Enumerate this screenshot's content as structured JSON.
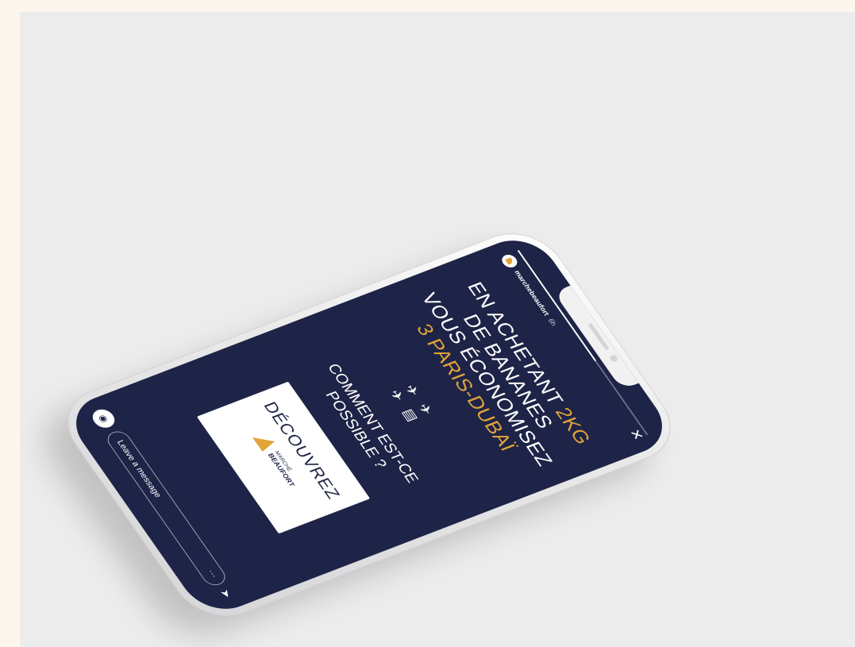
{
  "story": {
    "username": "marchebeaufort",
    "time": "6h",
    "progress_fraction": 0.6,
    "close_glyph": "✕",
    "headline": {
      "line1_a": "EN ACHETANT",
      "line1_b": "2KG",
      "line2": "DE BANANES",
      "line3": "VOUS ÉCONOMISEZ",
      "line4": "3 PARIS-DUBAÏ"
    },
    "icons": [
      "plane-icon",
      "plane-icon",
      "plane-icon",
      "banana-crate-icon"
    ],
    "question": {
      "line1": "COMMENT EST-CE",
      "line2": "POSSIBLE ?"
    },
    "cta": {
      "title": "DÉCOUVREZ",
      "logo_line1": "MARCHÉ",
      "logo_line2": "BEAUFORT"
    },
    "message_placeholder": "Leave a message",
    "more_glyph": "···"
  },
  "colors": {
    "background": "#fdf6ee",
    "backdrop": "#ececec",
    "screen": "#1e2447",
    "accent": "#e2a33a"
  }
}
